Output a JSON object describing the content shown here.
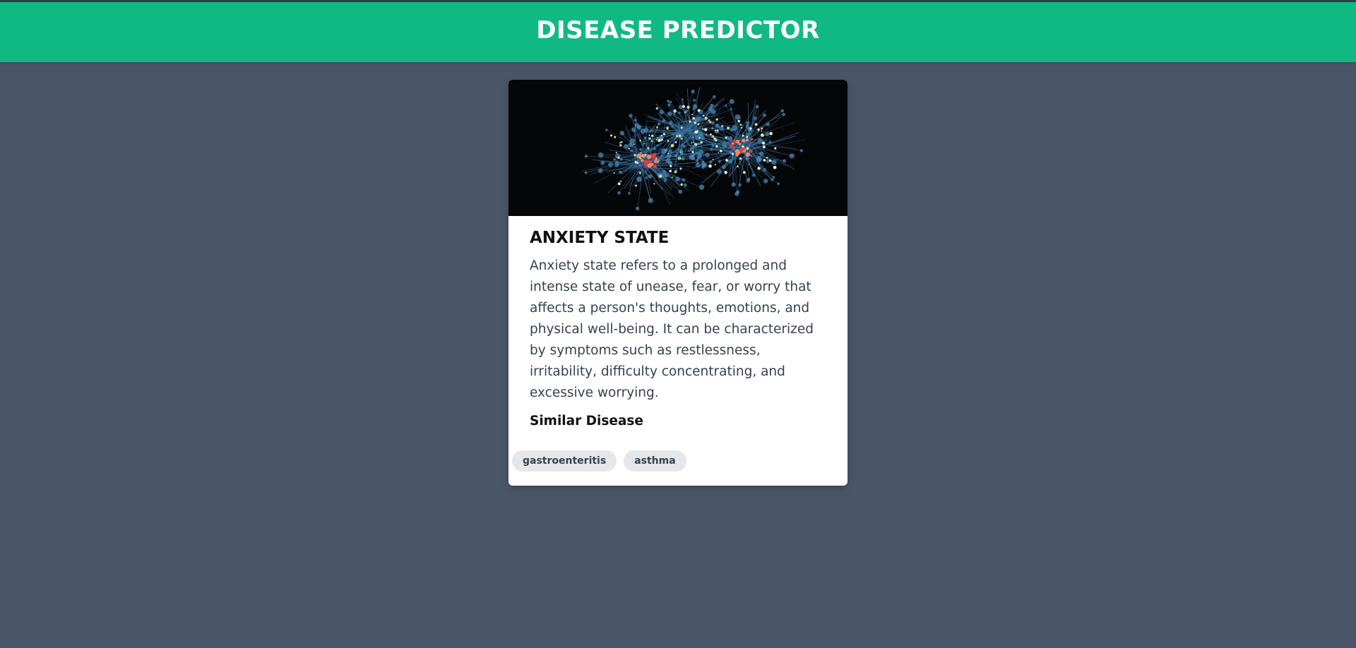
{
  "header": {
    "title": "DISEASE PREDICTOR",
    "background_color": "#10b981"
  },
  "card": {
    "image_icon": "neural-network-image",
    "title": "ANXIETY STATE",
    "description": "Anxiety state refers to a prolonged and intense state of unease, fear, or worry that affects a person's thoughts, emotions, and physical well-being. It can be characterized by symptoms such as restlessness, irritability, difficulty concentrating, and excessive worrying.",
    "similar_heading": "Similar Disease",
    "similar_tags": [
      "gastroenteritis",
      "asthma"
    ]
  },
  "colors": {
    "page_background": "#4a5568",
    "card_background": "#ffffff",
    "tag_background": "#e5e7eb"
  }
}
